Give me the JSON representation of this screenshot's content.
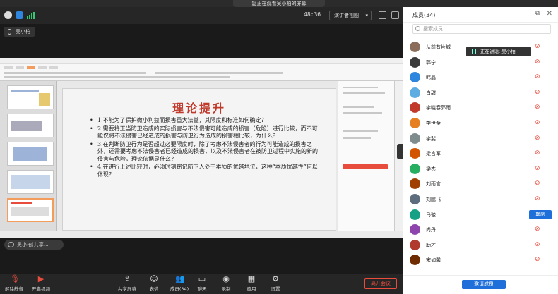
{
  "window": {
    "title": "您正在观看吴小柏的屏幕"
  },
  "meeting": {
    "timer": "48:36",
    "view_mode": "演讲者视图",
    "sharer_name": "吴小柏",
    "annotation_label": "吴小柏(共享…"
  },
  "slide": {
    "title": "理论提升",
    "bullets": [
      "1.不能为了保护微小利益而损害重大法益，其限度和标准如何确定？",
      "2.需要将正当防卫造成的实际损害与不法侵害可能造成的损害（危险）进行比较，而不可能仅将不法侵害已经造成的损害与防卫行为造成的损害相比较，为什么？",
      "3.在判断防卫行为是否超过必要限度时，除了考虑不法侵害者的行为可能造成的损害之外，还需要考虑不法侵害者已经造成的损害，以及不法侵害者在被防卫过程中实施的新的侵害与危险，理论依据是什么？",
      "4.在进行上述比较时，必须时刻铭记防卫人处于本质的优越地位，这种“本质优越性”何以体现？"
    ]
  },
  "toolbar": {
    "items": [
      {
        "label": "解除静音",
        "icon": "mic-off-icon"
      },
      {
        "label": "开启视频",
        "icon": "camera-off-icon"
      },
      {
        "label": "共享屏幕",
        "icon": "share-screen-icon"
      },
      {
        "label": "表情",
        "icon": "emoji-icon"
      },
      {
        "label": "成员(34)",
        "icon": "members-icon"
      },
      {
        "label": "聊天",
        "icon": "chat-icon"
      },
      {
        "label": "录制",
        "icon": "record-icon"
      },
      {
        "label": "应用",
        "icon": "apps-icon"
      },
      {
        "label": "设置",
        "icon": "settings-icon"
      }
    ],
    "leave_label": "离开会议"
  },
  "members_panel": {
    "title": "成员(34)",
    "search_placeholder": "搜索成员",
    "speaking_label": "正在讲话: 吴小柏",
    "members": [
      {
        "name": "从前有片城",
        "avatar_color": "#8a6d5a",
        "tag": ""
      },
      {
        "name": "郭宁",
        "avatar_color": "#3a3a3a",
        "tag": ""
      },
      {
        "name": "韩晶",
        "avatar_color": "#2e86de",
        "tag": ""
      },
      {
        "name": "白甜",
        "avatar_color": "#5dade2",
        "tag": ""
      },
      {
        "name": "李晓春郭雨",
        "avatar_color": "#c0392b",
        "tag": ""
      },
      {
        "name": "李世金",
        "avatar_color": "#e67e22",
        "tag": ""
      },
      {
        "name": "李斐",
        "avatar_color": "#7f8c8d",
        "tag": ""
      },
      {
        "name": "梁言军",
        "avatar_color": "#d35400",
        "tag": ""
      },
      {
        "name": "梁杰",
        "avatar_color": "#27ae60",
        "tag": ""
      },
      {
        "name": "刘雨言",
        "avatar_color": "#a04000",
        "tag": ""
      },
      {
        "name": "刘鹏飞",
        "avatar_color": "#5d6d7e",
        "tag": ""
      },
      {
        "name": "马骏",
        "avatar_color": "#16a085",
        "tag": "联席"
      },
      {
        "name": "尚丹",
        "avatar_color": "#8e44ad",
        "tag": ""
      },
      {
        "name": "助才",
        "avatar_color": "#b03a2e",
        "tag": ""
      },
      {
        "name": "宋如馨",
        "avatar_color": "#6e2c00",
        "tag": ""
      }
    ],
    "invite_label": "邀请成员"
  }
}
